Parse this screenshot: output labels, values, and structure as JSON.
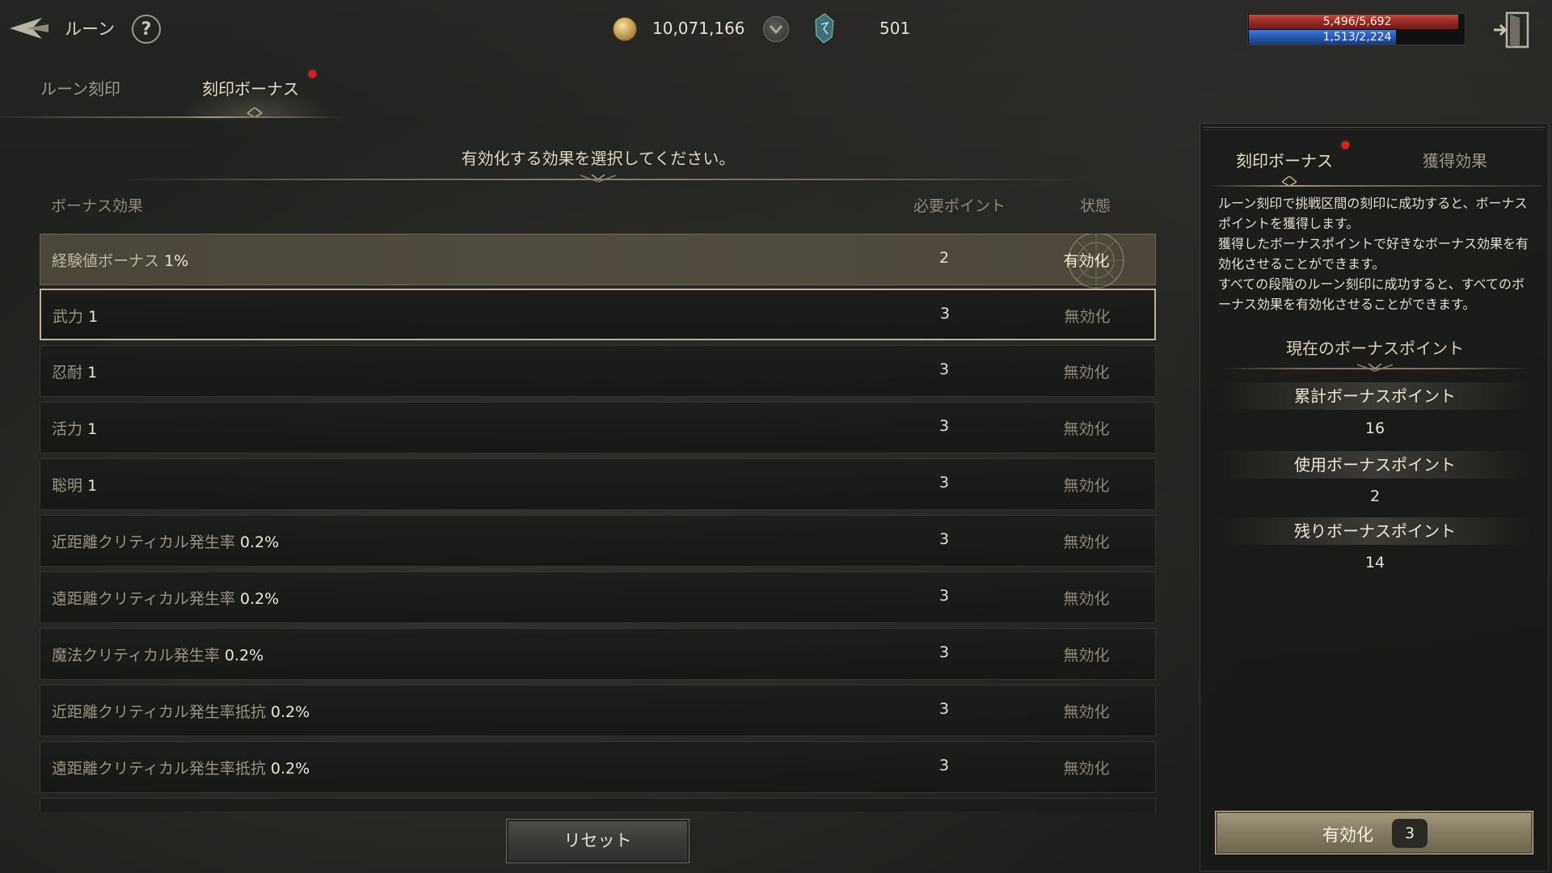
{
  "header": {
    "title": "ルーン",
    "help_label": "?",
    "gold": "10,071,166",
    "rune_points": "501",
    "hp_text": "5,496/5,692",
    "hp_fraction": 0.966,
    "mp_text": "1,513/2,224",
    "mp_fraction": 0.68,
    "colors": {
      "hp": "#a8342b",
      "mp": "#2d5fba",
      "accent": "#a39a80"
    }
  },
  "tabs": [
    {
      "label": "ルーン刻印",
      "active": false
    },
    {
      "label": "刻印ボーナス",
      "active": true,
      "notification": true
    }
  ],
  "main": {
    "instruction": "有効化する効果を選択してください。",
    "columns": {
      "effect": "ボーナス効果",
      "points": "必要ポイント",
      "status": "状態"
    },
    "rows": [
      {
        "name": "経験値ボーナス",
        "value": "1%",
        "points": "2",
        "status": "有効化"
      },
      {
        "name": "武力",
        "value": "1",
        "points": "3",
        "status": "無効化"
      },
      {
        "name": "忍耐",
        "value": "1",
        "points": "3",
        "status": "無効化"
      },
      {
        "name": "活力",
        "value": "1",
        "points": "3",
        "status": "無効化"
      },
      {
        "name": "聡明",
        "value": "1",
        "points": "3",
        "status": "無効化"
      },
      {
        "name": "近距離クリティカル発生率",
        "value": "0.2%",
        "points": "3",
        "status": "無効化"
      },
      {
        "name": "遠距離クリティカル発生率",
        "value": "0.2%",
        "points": "3",
        "status": "無効化"
      },
      {
        "name": "魔法クリティカル発生率",
        "value": "0.2%",
        "points": "3",
        "status": "無効化"
      },
      {
        "name": "近距離クリティカル発生率抵抗",
        "value": "0.2%",
        "points": "3",
        "status": "無効化"
      },
      {
        "name": "遠距離クリティカル発生率抵抗",
        "value": "0.2%",
        "points": "3",
        "status": "無効化"
      }
    ],
    "reset_label": "リセット"
  },
  "side": {
    "tabs": [
      {
        "label": "刻印ボーナス",
        "active": true,
        "notification": true
      },
      {
        "label": "獲得効果",
        "active": false
      }
    ],
    "description": "ルーン刻印で挑戦区間の刻印に成功すると、ボーナスポイントを獲得します。\n獲得したボーナスポイントで好きなボーナス効果を有効化させることができます。\nすべての段階のルーン刻印に成功すると、すべてのボーナス効果を有効化させることができます。",
    "current_title": "現在のボーナスポイント",
    "stats": [
      {
        "label": "累計ボーナスポイント",
        "value": "16"
      },
      {
        "label": "使用ボーナスポイント",
        "value": "2"
      },
      {
        "label": "残りボーナスポイント",
        "value": "14"
      }
    ],
    "apply_label": "有効化",
    "apply_count": "3"
  }
}
